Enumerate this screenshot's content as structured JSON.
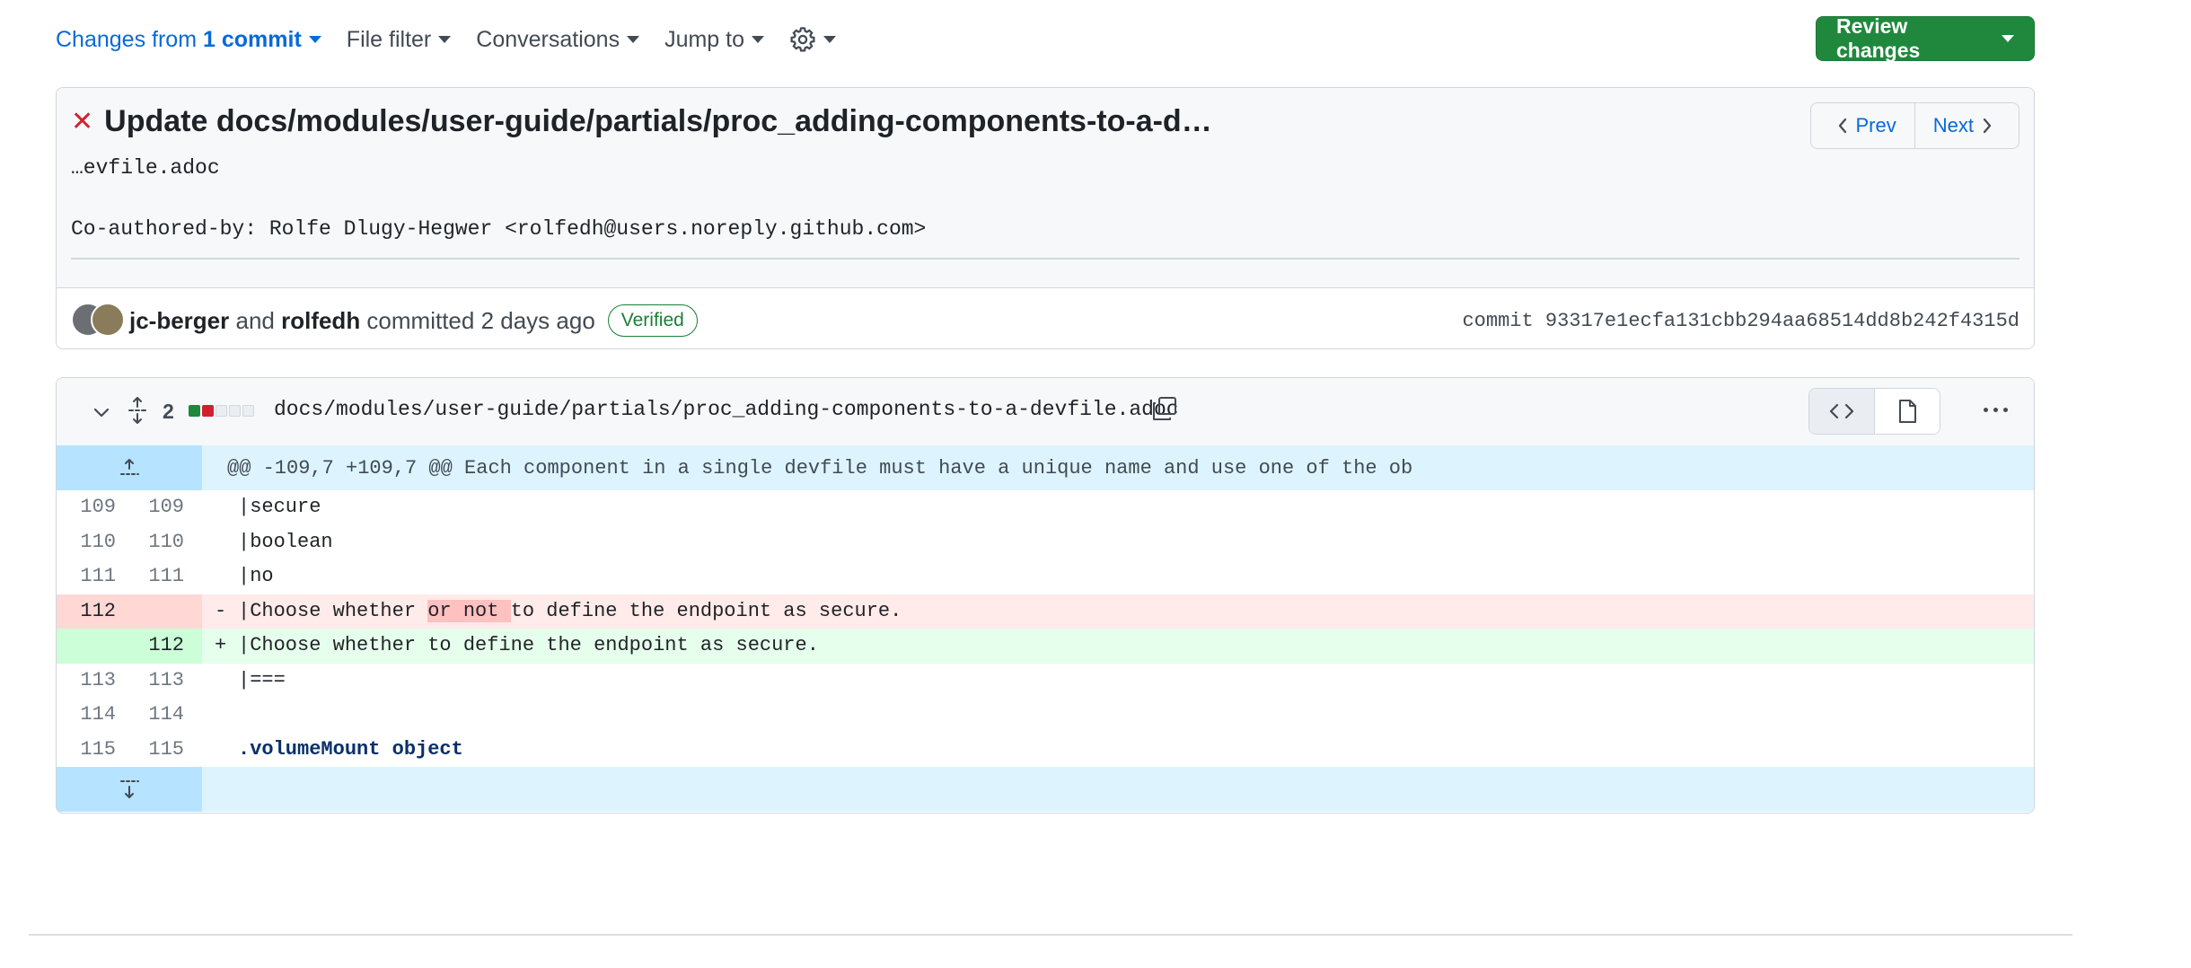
{
  "toolbar": {
    "changes_prefix": "Changes from",
    "changes_commit": "1 commit",
    "file_filter": "File filter",
    "conversations": "Conversations",
    "jump_to": "Jump to",
    "review_button": "Review changes",
    "settings_icon": "gear-icon"
  },
  "commit": {
    "status_icon": "x-icon",
    "title": "Update docs/modules/user-guide/partials/proc_adding-components-to-a-d…",
    "description": "…evfile.adoc\n\nCo-authored-by: Rolfe Dlugy-Hegwer <rolfedh@users.noreply.github.com>",
    "prev_label": "Prev",
    "next_label": "Next",
    "author1": "jc-berger",
    "and_text": " and ",
    "author2": "rolfedh",
    "committed_text": " committed 2 days ago",
    "verified_label": "Verified",
    "sha": "commit 93317e1ecfa131cbb294aa68514dd8b242f4315d"
  },
  "file": {
    "changed_lines": "2",
    "path": "docs/modules/user-guide/partials/proc_adding-components-to-a-devfile.adoc",
    "hunk_header": "@@ -109,7 +109,7 @@ Each component in a single devfile must have a unique name and use one of the ob",
    "rows": [
      {
        "type": "ctx",
        "old": "109",
        "new": "109",
        "text": "|secure"
      },
      {
        "type": "ctx",
        "old": "110",
        "new": "110",
        "text": "|boolean"
      },
      {
        "type": "ctx",
        "old": "111",
        "new": "111",
        "text": "|no"
      },
      {
        "type": "del",
        "old": "112",
        "new": "",
        "sign": "-",
        "before": "|Choose whether ",
        "highlight": "or not ",
        "after": "to define the endpoint as secure."
      },
      {
        "type": "add",
        "old": "",
        "new": "112",
        "sign": "+",
        "text": "|Choose whether to define the endpoint as secure."
      },
      {
        "type": "ctx",
        "old": "113",
        "new": "113",
        "text": "|==="
      },
      {
        "type": "ctx",
        "old": "114",
        "new": "114",
        "text": ""
      },
      {
        "type": "ctx",
        "old": "115",
        "new": "115",
        "text": ".volumeMount object"
      }
    ]
  },
  "colors": {
    "accent_blue": "#0969da",
    "review_green": "#1f883d",
    "deleted_bg": "#ffebe9",
    "added_bg": "#e6ffec",
    "hunk_bg": "#ddf4ff"
  }
}
